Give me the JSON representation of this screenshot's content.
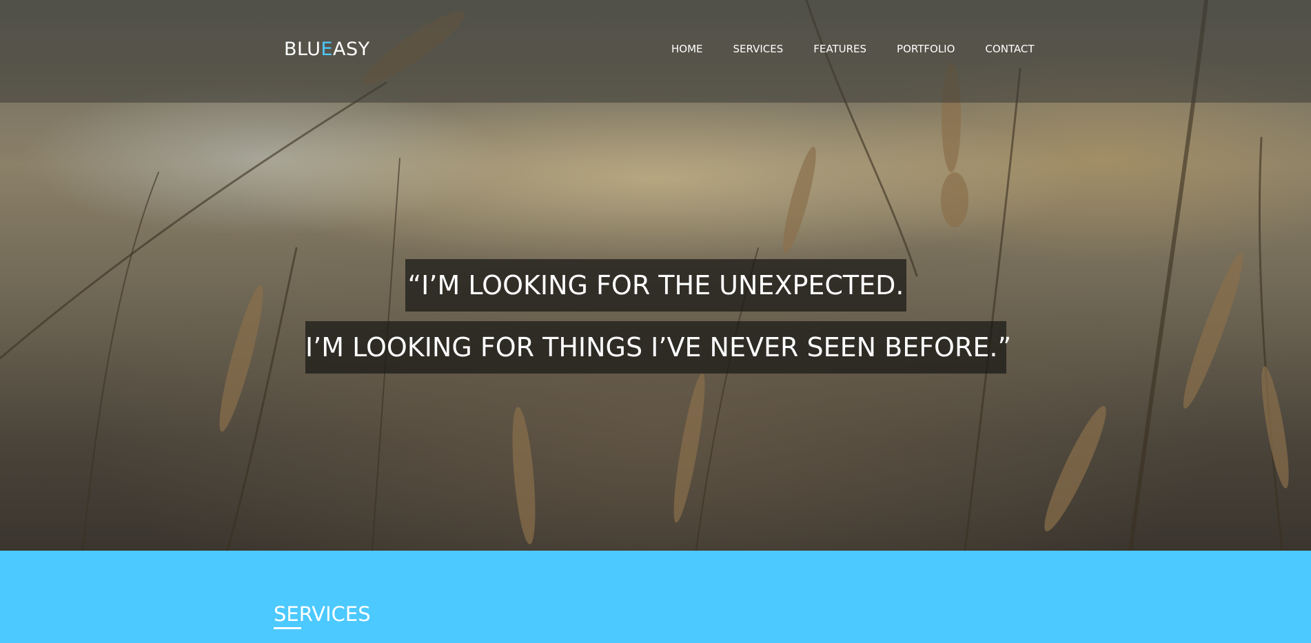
{
  "brand": {
    "prefix": "BLU",
    "accent": "E",
    "suffix": "ASY",
    "accent_color": "#4cc9ff"
  },
  "nav": {
    "items": [
      {
        "label": "HOME"
      },
      {
        "label": "SERVICES"
      },
      {
        "label": "FEATURES"
      },
      {
        "label": "PORTFOLIO"
      },
      {
        "label": "CONTACT"
      }
    ]
  },
  "hero": {
    "quote_line_1": "“I’M LOOKING FOR THE UNEXPECTED.",
    "quote_line_2": "I’M LOOKING FOR THINGS I’VE NEVER SEEN BEFORE.”",
    "background_image": "wheat-field-photo"
  },
  "services": {
    "title": "SERVICES",
    "background_color": "#4cc9ff"
  }
}
